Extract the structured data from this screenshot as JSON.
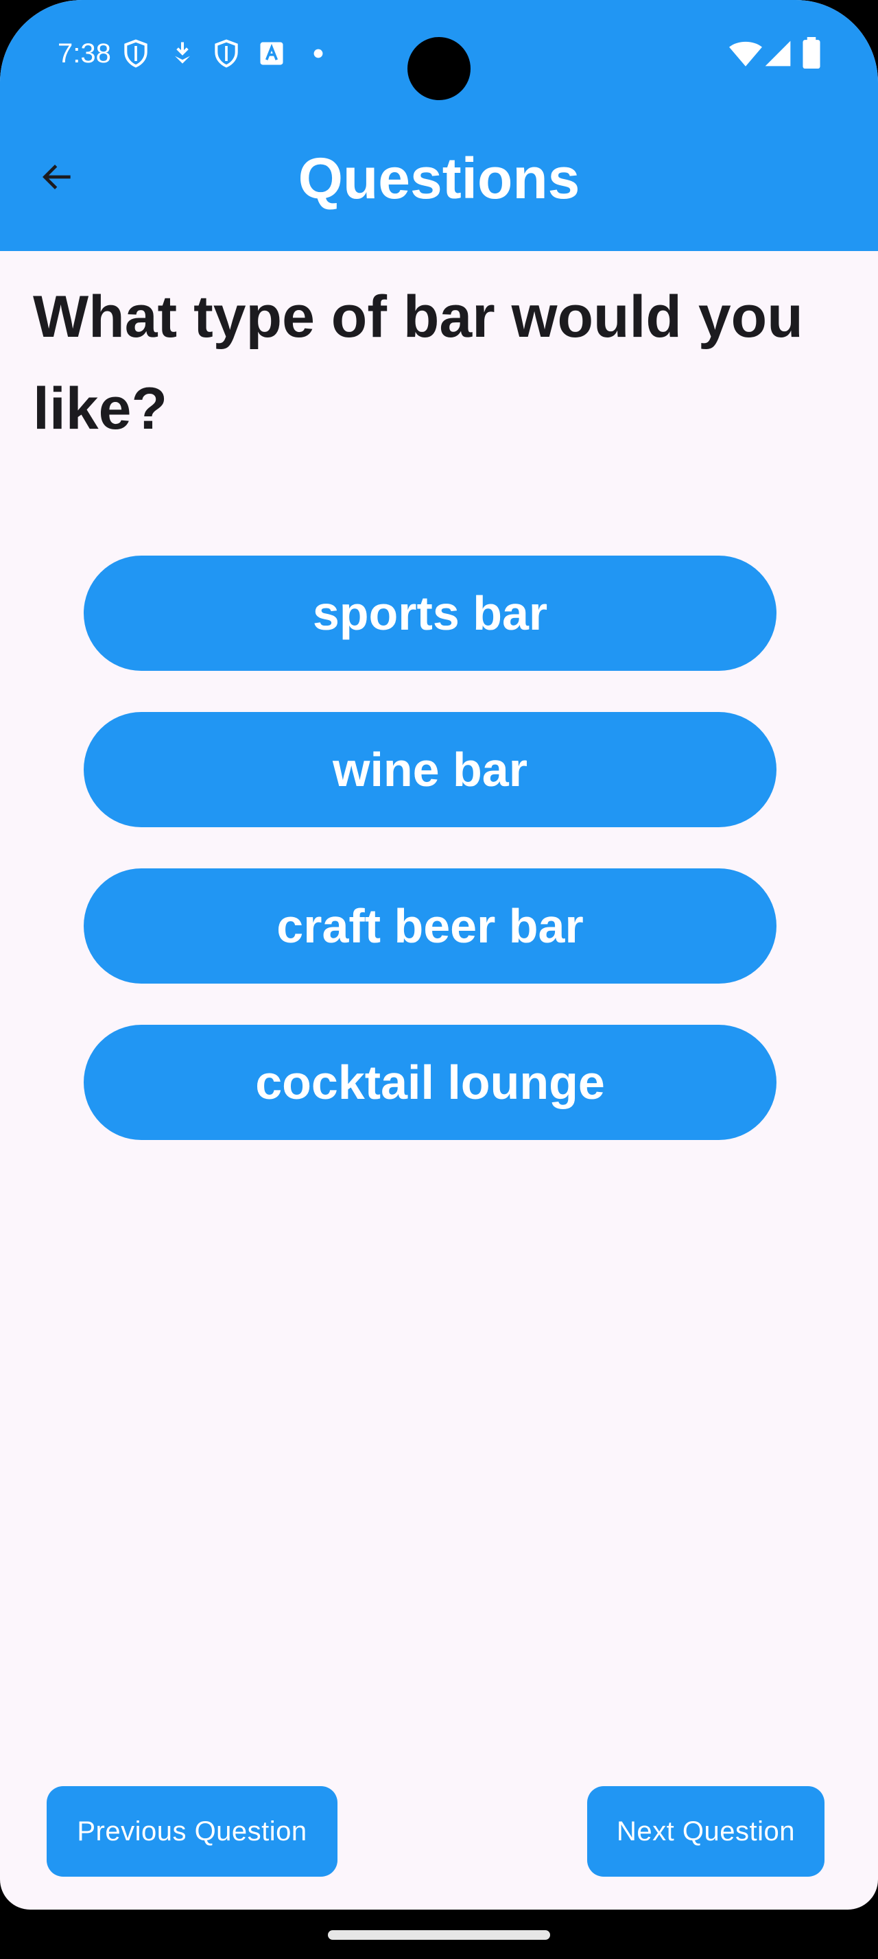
{
  "status_bar": {
    "time": "7:38",
    "left_icons": [
      "shield-icon",
      "download-badge-icon",
      "shield-icon",
      "translate-icon",
      "dot-icon"
    ],
    "right_icons": [
      "wifi-icon",
      "cellular-signal-icon",
      "battery-icon"
    ]
  },
  "app_bar": {
    "title": "Questions",
    "back_icon": "arrow-left-icon"
  },
  "question": {
    "text": "What type of bar would you like?"
  },
  "answers": [
    {
      "label": "sports bar"
    },
    {
      "label": "wine bar"
    },
    {
      "label": "craft beer bar"
    },
    {
      "label": "cocktail lounge"
    }
  ],
  "navigation": {
    "previous_label": "Previous Question",
    "next_label": "Next Question"
  },
  "colors": {
    "primary": "#2196F3",
    "background": "#FCF6FC",
    "text": "#1C1B1F",
    "on_primary": "#FFFFFF"
  }
}
